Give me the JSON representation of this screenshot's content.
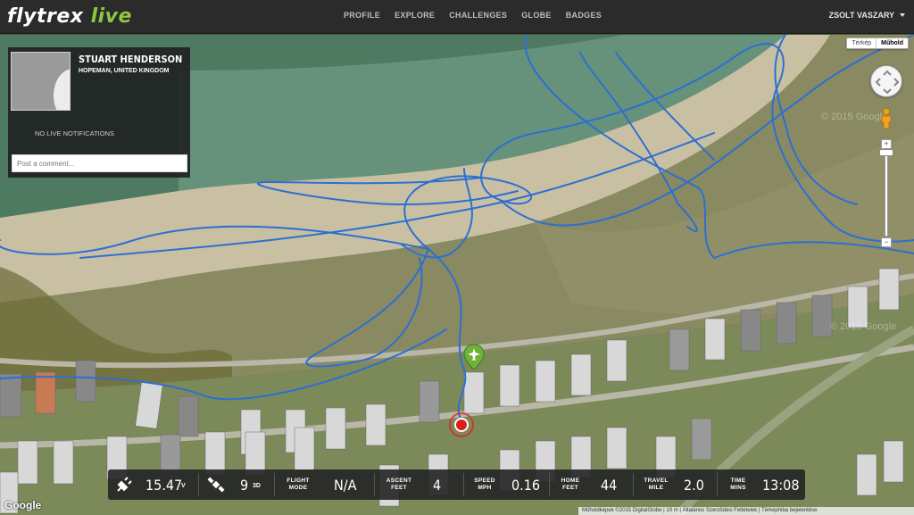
{
  "brand": {
    "logo_main": "flytrex",
    "logo_accent": " live"
  },
  "nav": {
    "items": [
      "PROFILE",
      "EXPLORE",
      "CHALLENGES",
      "GLOBE",
      "BADGES"
    ]
  },
  "user": {
    "name": "ZSOLT VASZARY"
  },
  "panel": {
    "pilot_name": "STUART HENDERSON",
    "location": "HOPEMAN, UNITED KINGDOM",
    "notifications": "NO LIVE NOTIFICATIONS",
    "comment_placeholder": "Post a comment..."
  },
  "map": {
    "type_options": [
      "Térkép",
      "Műhold"
    ],
    "selected_type": "Műhold",
    "google_label": "Google",
    "attribution": "Műholdképek ©2015 DigitalGlobe  |  10 m  |  Általános Szerződési Feltételek  |  Térképhiba bejelentése"
  },
  "stats": {
    "battery": {
      "value": "15.47",
      "unit": "V"
    },
    "satellites": {
      "value": "9",
      "unit": "3D"
    },
    "flight_mode": {
      "label_1": "FLIGHT",
      "label_2": "MODE",
      "value": "N/A"
    },
    "ascent": {
      "label_1": "ASCENT",
      "label_2": "FEET",
      "value": "4"
    },
    "speed": {
      "label_1": "SPEED",
      "label_2": "MPH",
      "value": "0.16"
    },
    "home": {
      "label_1": "HOME",
      "label_2": "FEET",
      "value": "44"
    },
    "travel": {
      "label_1": "TRAVEL",
      "label_2": "MILE",
      "value": "2.0"
    },
    "time": {
      "label_1": "TIME",
      "label_2": "MINS",
      "value": "13:08"
    }
  },
  "colors": {
    "accent": "#8ec63f",
    "track": "#2d6fd1",
    "end_marker": "#e01b1b",
    "drone_marker": "#6fb23a"
  }
}
